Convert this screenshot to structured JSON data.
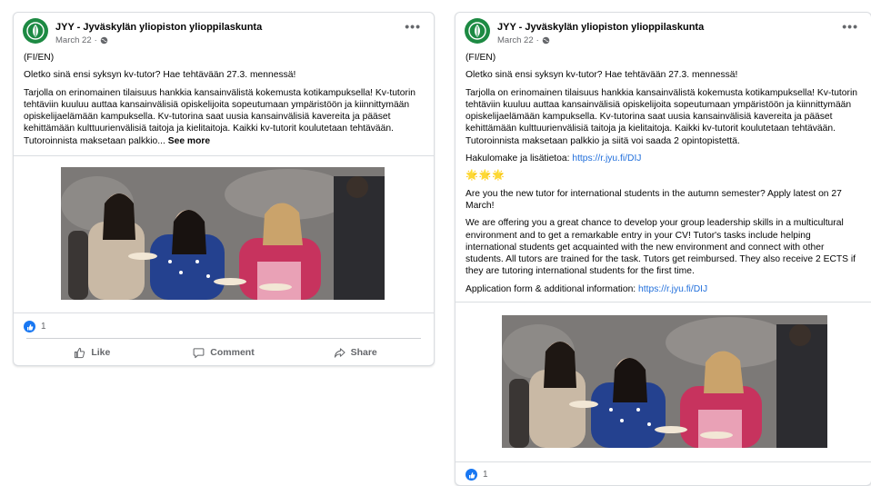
{
  "posts": [
    {
      "page_name": "JYY - Jyväskylän yliopiston ylioppilaskunta",
      "date": "March 22",
      "more_label": "•••",
      "lang_tag": "(FI/EN)",
      "headline": "Oletko sinä ensi syksyn kv-tutor? Hae tehtävään 27.3. mennessä!",
      "body": "Tarjolla on erinomainen tilaisuus hankkia kansainvälistä kokemusta kotikampuksella! Kv-tutorin tehtäviin kuuluu auttaa kansainvälisiä opiskelijoita sopeutumaan ympäristöön ja kiinnittymään opiskelijaelämään kampuksella. Kv-tutorina saat uusia kansainvälisiä kavereita ja pääset kehittämään kulttuurienvälisiä taitoja ja kielitaitoja. Kaikki kv-tutorit koulutetaan tehtävään. Tutoroinnista maksetaan palkkio...",
      "see_more": "See more",
      "reaction_count": "1",
      "actions": {
        "like": "Like",
        "comment": "Comment",
        "share": "Share"
      }
    },
    {
      "page_name": "JYY - Jyväskylän yliopiston ylioppilaskunta",
      "date": "March 22",
      "more_label": "•••",
      "lang_tag": "(FI/EN)",
      "headline": "Oletko sinä ensi syksyn kv-tutor? Hae tehtävään 27.3. mennessä!",
      "body": "Tarjolla on erinomainen tilaisuus hankkia kansainvälistä kokemusta kotikampuksella! Kv-tutorin tehtäviin kuuluu auttaa kansainvälisiä opiskelijoita sopeutumaan ympäristöön ja kiinnittymään opiskelijaelämään kampuksella. Kv-tutorina saat uusia kansainvälisiä kavereita ja pääset kehittämään kulttuurienvälisiä taitoja ja kielitaitoja. Kaikki kv-tutorit koulutetaan tehtävään. Tutoroinnista maksetaan palkkio ja siitä voi saada 2 opintopistettä.",
      "apply_fi_label": "Hakulomake ja lisätietoa:",
      "apply_fi_link": "https://r.jyu.fi/DIJ",
      "emojis": "🌟🌟🌟",
      "en_headline": "Are you the new tutor for international students in the autumn semester? Apply latest on 27 March!",
      "en_body": "We are offering you a great chance to develop your group leadership skills in a multicultural environment and to get a remarkable entry in your CV! Tutor's tasks include helping international students get acquainted with the new environment and connect with other students. All tutors are trained for the task. Tutors get reimbursed. They also receive 2 ECTS if they are tutoring international students for the first time.",
      "apply_en_label": "Application form & additional information:",
      "apply_en_link": "https://r.jyu.fi/DIJ",
      "reaction_count": "1"
    }
  ],
  "colors": {
    "brand_green": "#1d8a43",
    "link_blue": "#216fdb",
    "like_blue": "#1877f2",
    "meta_gray": "#65676b"
  },
  "icons": [
    "jyy-logo-icon",
    "globe-icon",
    "more-options-icon",
    "like-reaction-icon",
    "thumbs-up-icon",
    "comment-icon",
    "share-icon"
  ]
}
